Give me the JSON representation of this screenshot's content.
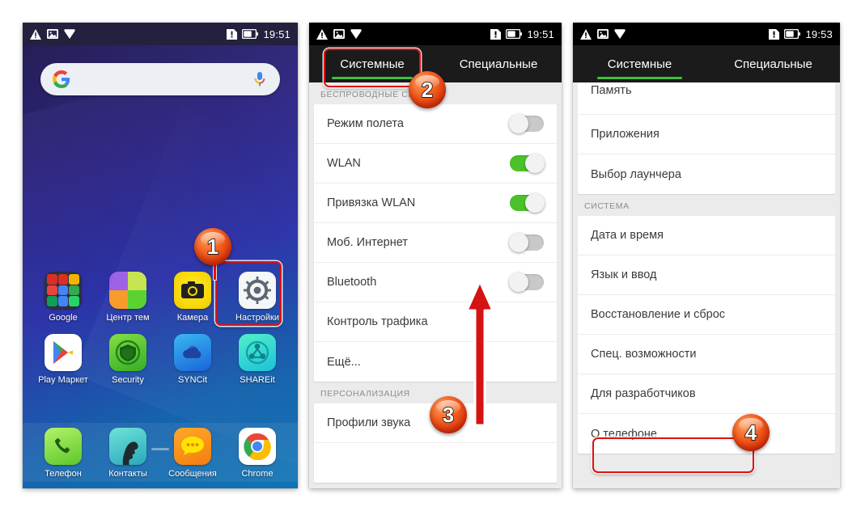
{
  "statusbar": {
    "icons_left": [
      "warning-triangle-icon",
      "image-icon",
      "chevron-down-icon"
    ],
    "icons_right": [
      "sim-alert-icon",
      "battery-icon"
    ],
    "time_home": "19:51",
    "time_settings": "19:51",
    "time_system": "19:53"
  },
  "home": {
    "search": {
      "placeholder": "",
      "left_icon": "google-g-icon",
      "right_icon": "microphone-icon"
    },
    "apps_row1": [
      {
        "label": "Google",
        "icon": "google-folder-icon"
      },
      {
        "label": "Центр тем",
        "icon": "theme-center-icon"
      },
      {
        "label": "Камера",
        "icon": "camera-icon"
      },
      {
        "label": "Настройки",
        "icon": "settings-gear-icon"
      }
    ],
    "apps_row2": [
      {
        "label": "Play Маркет",
        "icon": "play-store-icon"
      },
      {
        "label": "Security",
        "icon": "security-shield-icon"
      },
      {
        "label": "SYNCit",
        "icon": "syncit-cloud-icon"
      },
      {
        "label": "SHAREit",
        "icon": "shareit-icon"
      }
    ],
    "dock": [
      {
        "label": "Телефон",
        "icon": "phone-handset-icon"
      },
      {
        "label": "Контакты",
        "icon": "contacts-person-icon"
      },
      {
        "label": "Сообщения",
        "icon": "messages-bubble-icon"
      },
      {
        "label": "Chrome",
        "icon": "chrome-icon"
      }
    ],
    "page_dots": 3,
    "active_dot": 0
  },
  "settings": {
    "tabs": [
      {
        "label": "Системные",
        "active": true
      },
      {
        "label": "Специальные",
        "active": false
      }
    ],
    "section1_title": "БЕСПРОВОДНЫЕ СЕТИ",
    "section1_rows": [
      {
        "label": "Режим полета",
        "toggle": "off"
      },
      {
        "label": "WLAN",
        "toggle": "on"
      },
      {
        "label": "Привязка WLAN",
        "toggle": "on"
      },
      {
        "label": "Моб. Интернет",
        "toggle": "off"
      },
      {
        "label": "Bluetooth",
        "toggle": "off"
      },
      {
        "label": "Контроль трафика",
        "toggle": "none"
      },
      {
        "label": "Ещё...",
        "toggle": "none"
      }
    ],
    "section2_title": "ПЕРСОНАЛИЗАЦИЯ",
    "section2_rows": [
      {
        "label": "Профили звука",
        "toggle": "none"
      }
    ]
  },
  "system": {
    "tabs": [
      {
        "label": "Системные",
        "active": true
      },
      {
        "label": "Специальные",
        "active": false
      }
    ],
    "top_rows": [
      {
        "label": "Память"
      },
      {
        "label": "Приложения"
      },
      {
        "label": "Выбор лаунчера"
      }
    ],
    "section_title": "СИСТЕМА",
    "rows": [
      {
        "label": "Дата и время"
      },
      {
        "label": "Язык и ввод"
      },
      {
        "label": "Восстановление и сброс"
      },
      {
        "label": "Спец. возможности"
      },
      {
        "label": "Для разработчиков"
      },
      {
        "label": "О телефоне"
      }
    ]
  },
  "annotations": {
    "badge1": "1",
    "badge2": "2",
    "badge3": "3",
    "badge4": "4",
    "arrow_color": "#d41313",
    "highlight_color": "#e01010",
    "accent_green": "#3fbf3f"
  }
}
